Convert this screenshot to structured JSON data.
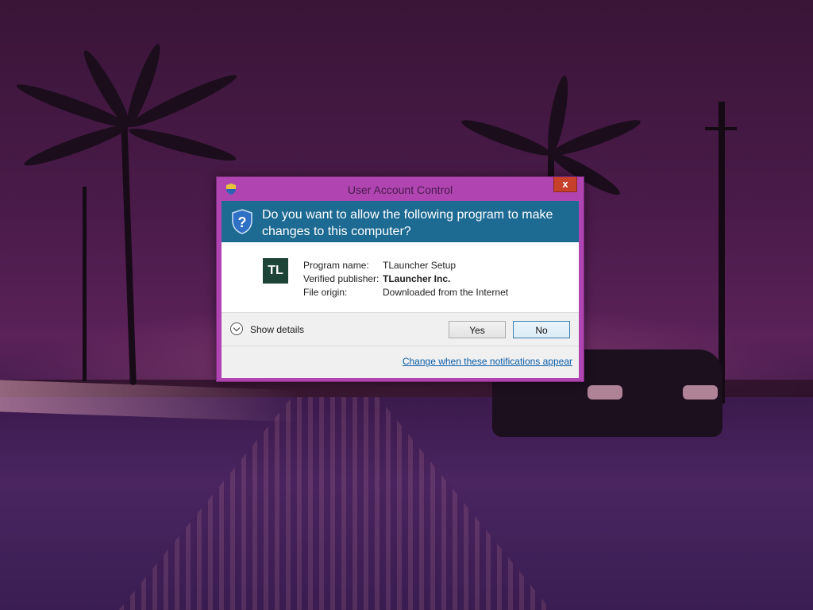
{
  "dialog": {
    "title": "User Account Control",
    "close_glyph": "x",
    "question": "Do you want to allow the following program to make changes to this computer?",
    "app_icon_text": "TL",
    "info": {
      "program_name_label": "Program name:",
      "program_name_value": "TLauncher Setup",
      "publisher_label": "Verified publisher:",
      "publisher_value": "TLauncher Inc.",
      "origin_label": "File origin:",
      "origin_value": "Downloaded from the Internet"
    },
    "show_details_label": "Show details",
    "yes_label": "Yes",
    "no_label": "No",
    "change_link": "Change when these notifications appear"
  },
  "icons": {
    "title_icon": "uac-shield-icon",
    "banner_icon": "question-shield-icon",
    "details_icon": "chevron-down-icon"
  },
  "colors": {
    "dialog_frame": "#b045b2",
    "banner": "#1d6a93",
    "close_button": "#c7402a",
    "link": "#0b5ea8"
  }
}
